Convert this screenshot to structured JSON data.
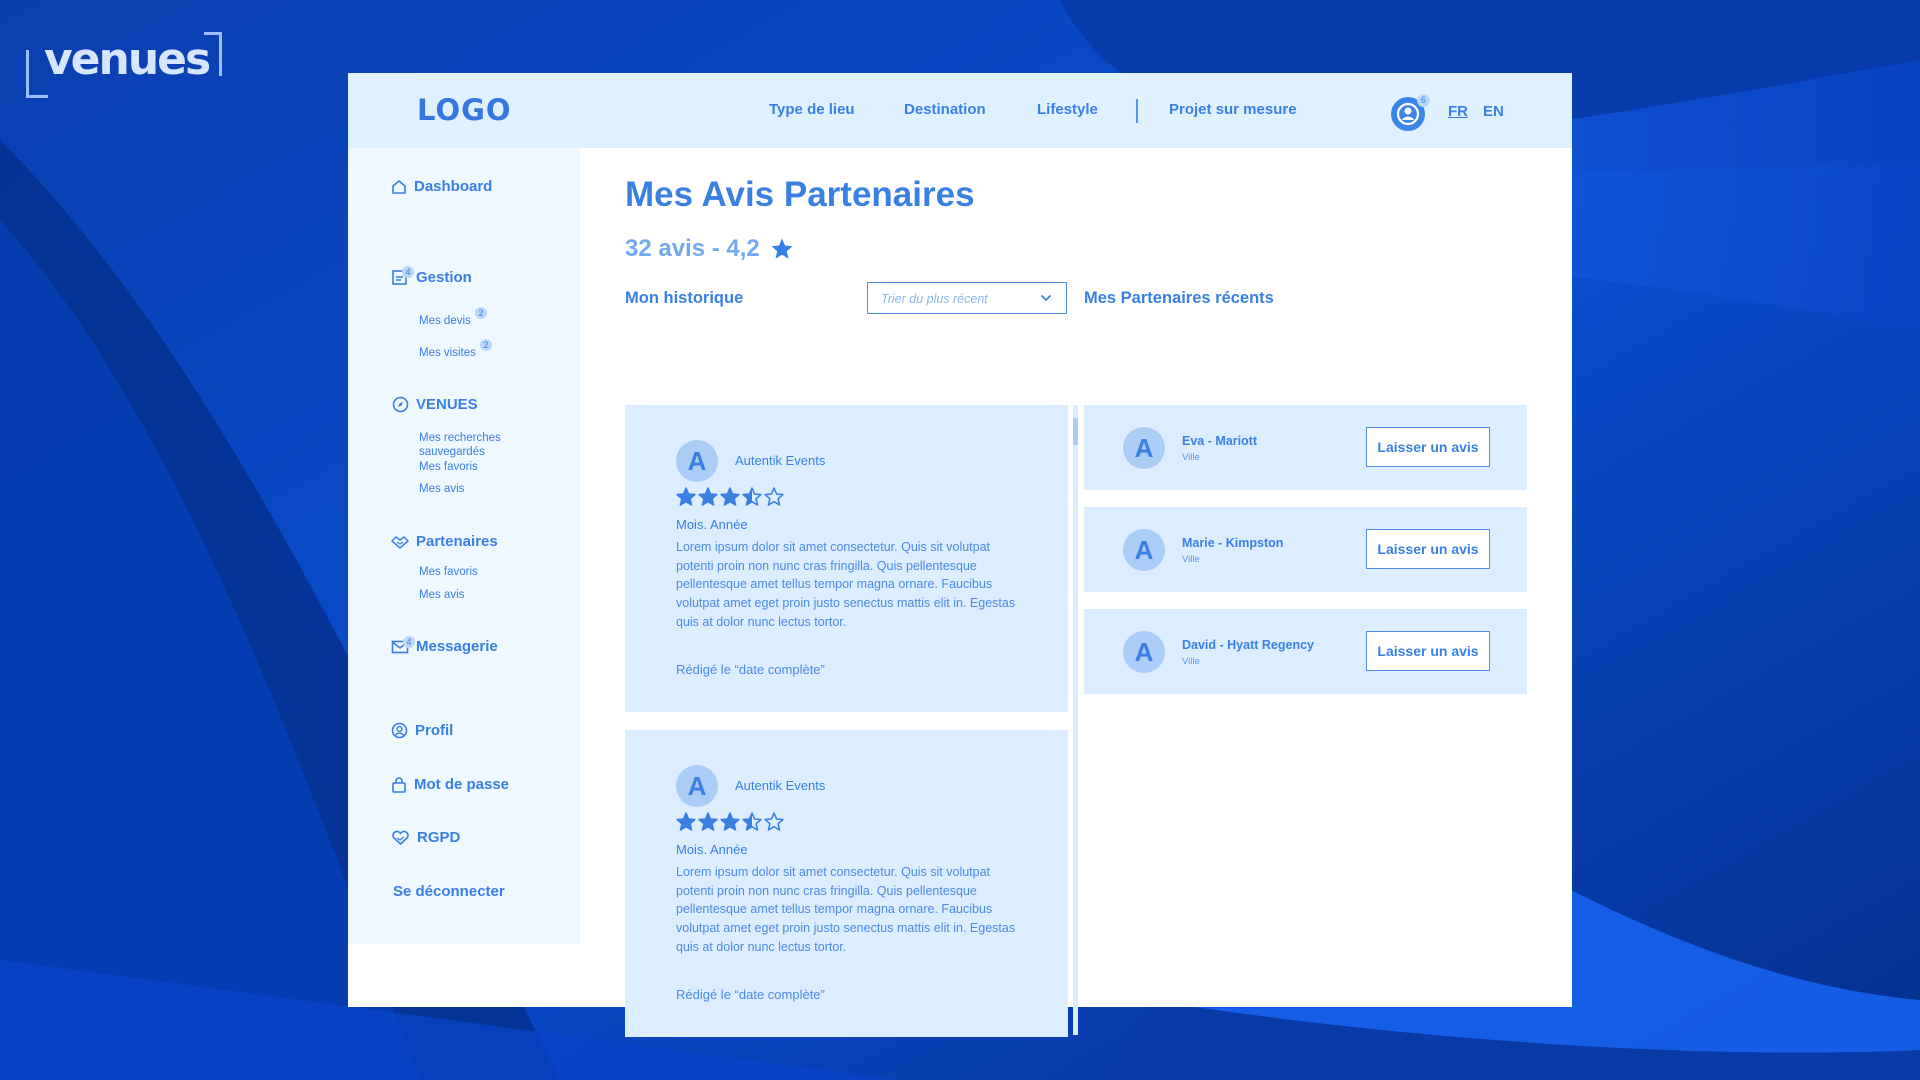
{
  "brand": {
    "name": "venues"
  },
  "header": {
    "logo": "LOGO",
    "nav": [
      "Type de lieu",
      "Destination",
      "Lifestyle"
    ],
    "custom_project": "Projet sur mesure",
    "account_badge": "6",
    "languages": {
      "fr": "FR",
      "en": "EN",
      "active": "FR"
    }
  },
  "sidebar": {
    "dashboard": "Dashboard",
    "gestion": {
      "label": "Gestion",
      "badge": "4",
      "devis": "Mes devis",
      "devis_badge": "2",
      "visites": "Mes visites",
      "visites_badge": "2"
    },
    "venues": {
      "label": "VENUES",
      "recherches_line1": "Mes recherches",
      "recherches_line2": "sauvegardés",
      "favoris": "Mes favoris",
      "avis": "Mes avis"
    },
    "partenaires": {
      "label": "Partenaires",
      "favoris": "Mes favoris",
      "avis": "Mes avis"
    },
    "messagerie": {
      "label": "Messagerie",
      "badge": "4"
    },
    "profil": "Profil",
    "password": "Mot de passe",
    "rgpd": "RGPD",
    "logout": "Se déconnecter"
  },
  "main": {
    "title": "Mes Avis Partenaires",
    "summary": "32 avis - 4,2",
    "history_label": "Mon historique",
    "sort_placeholder": "Trier du plus récent",
    "recent_label": "Mes Partenaires récents",
    "reviews": [
      {
        "initial": "A",
        "name": "Autentik Events",
        "rating": 3.5,
        "date": "Mois. Année",
        "text": "Lorem ipsum dolor sit amet consectetur. Quis sit volutpat potenti proin non nunc cras fringilla. Quis pellentesque pellentesque amet tellus tempor magna ornare. Faucibus volutpat amet eget proin justo senectus mattis elit in. Egestas quis at dolor nunc lectus tortor.",
        "written": "Rédigé le “date complète”"
      },
      {
        "initial": "A",
        "name": "Autentik Events",
        "rating": 3.5,
        "date": "Mois. Année",
        "text": "Lorem ipsum dolor sit amet consectetur. Quis sit volutpat potenti proin non nunc cras fringilla. Quis pellentesque pellentesque amet tellus tempor magna ornare. Faucibus volutpat amet eget proin justo senectus mattis elit in. Egestas quis at dolor nunc lectus tortor.",
        "written": "Rédigé le “date complète”"
      }
    ],
    "partners": [
      {
        "initial": "A",
        "name": "Eva - Mariott",
        "city": "Ville",
        "button": "Laisser un avis"
      },
      {
        "initial": "A",
        "name": "Marie - Kimpston",
        "city": "Ville",
        "button": "Laisser un avis"
      },
      {
        "initial": "A",
        "name": "David - Hyatt Regency",
        "city": "Ville",
        "button": "Laisser un avis"
      }
    ]
  },
  "colors": {
    "accent": "#3a80e2",
    "topbar": "#dff0ff",
    "sidebar": "#eff7ff",
    "card": "#dcedff",
    "avatar": "#a9cdf6",
    "background": "#0a3fb8"
  },
  "icons": [
    "home-icon",
    "clipboard-icon",
    "compass-icon",
    "handshake-icon",
    "mail-icon",
    "user-circle-icon",
    "lock-icon",
    "heart-hand-icon",
    "star-icon",
    "chevron-down-icon",
    "account-icon"
  ]
}
